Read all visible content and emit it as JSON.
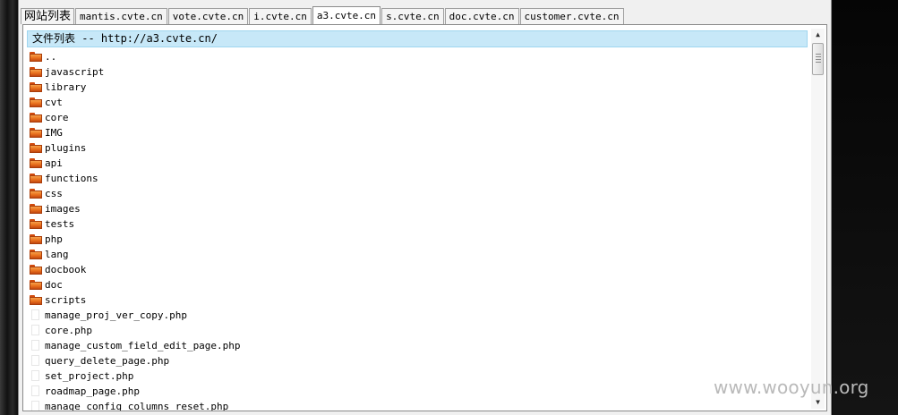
{
  "tabs": [
    {
      "label": "网站列表",
      "active": false
    },
    {
      "label": "mantis.cvte.cn",
      "active": false
    },
    {
      "label": "vote.cvte.cn",
      "active": false
    },
    {
      "label": "i.cvte.cn",
      "active": false
    },
    {
      "label": "a3.cvte.cn",
      "active": true
    },
    {
      "label": "s.cvte.cn",
      "active": false
    },
    {
      "label": "doc.cvte.cn",
      "active": false
    },
    {
      "label": "customer.cvte.cn",
      "active": false
    }
  ],
  "file_list": {
    "header": "文件列表 -- http://a3.cvte.cn/",
    "items": [
      {
        "name": "..",
        "type": "folder"
      },
      {
        "name": "javascript",
        "type": "folder"
      },
      {
        "name": "library",
        "type": "folder"
      },
      {
        "name": "cvt",
        "type": "folder"
      },
      {
        "name": "core",
        "type": "folder"
      },
      {
        "name": "IMG",
        "type": "folder"
      },
      {
        "name": "plugins",
        "type": "folder"
      },
      {
        "name": "api",
        "type": "folder"
      },
      {
        "name": "functions",
        "type": "folder"
      },
      {
        "name": "css",
        "type": "folder"
      },
      {
        "name": "images",
        "type": "folder"
      },
      {
        "name": "tests",
        "type": "folder"
      },
      {
        "name": "php",
        "type": "folder"
      },
      {
        "name": "lang",
        "type": "folder"
      },
      {
        "name": "docbook",
        "type": "folder"
      },
      {
        "name": "doc",
        "type": "folder"
      },
      {
        "name": "scripts",
        "type": "folder"
      },
      {
        "name": "manage_proj_ver_copy.php",
        "type": "file"
      },
      {
        "name": "core.php",
        "type": "file"
      },
      {
        "name": "manage_custom_field_edit_page.php",
        "type": "file"
      },
      {
        "name": "query_delete_page.php",
        "type": "file"
      },
      {
        "name": "set_project.php",
        "type": "file"
      },
      {
        "name": "roadmap_page.php",
        "type": "file"
      },
      {
        "name": "manage_config_columns_reset.php",
        "type": "file"
      }
    ]
  },
  "scrollbar": {
    "up_icon": "arrow-up-icon",
    "down_icon": "arrow-down-icon"
  },
  "watermark": "www.wooyun.org"
}
